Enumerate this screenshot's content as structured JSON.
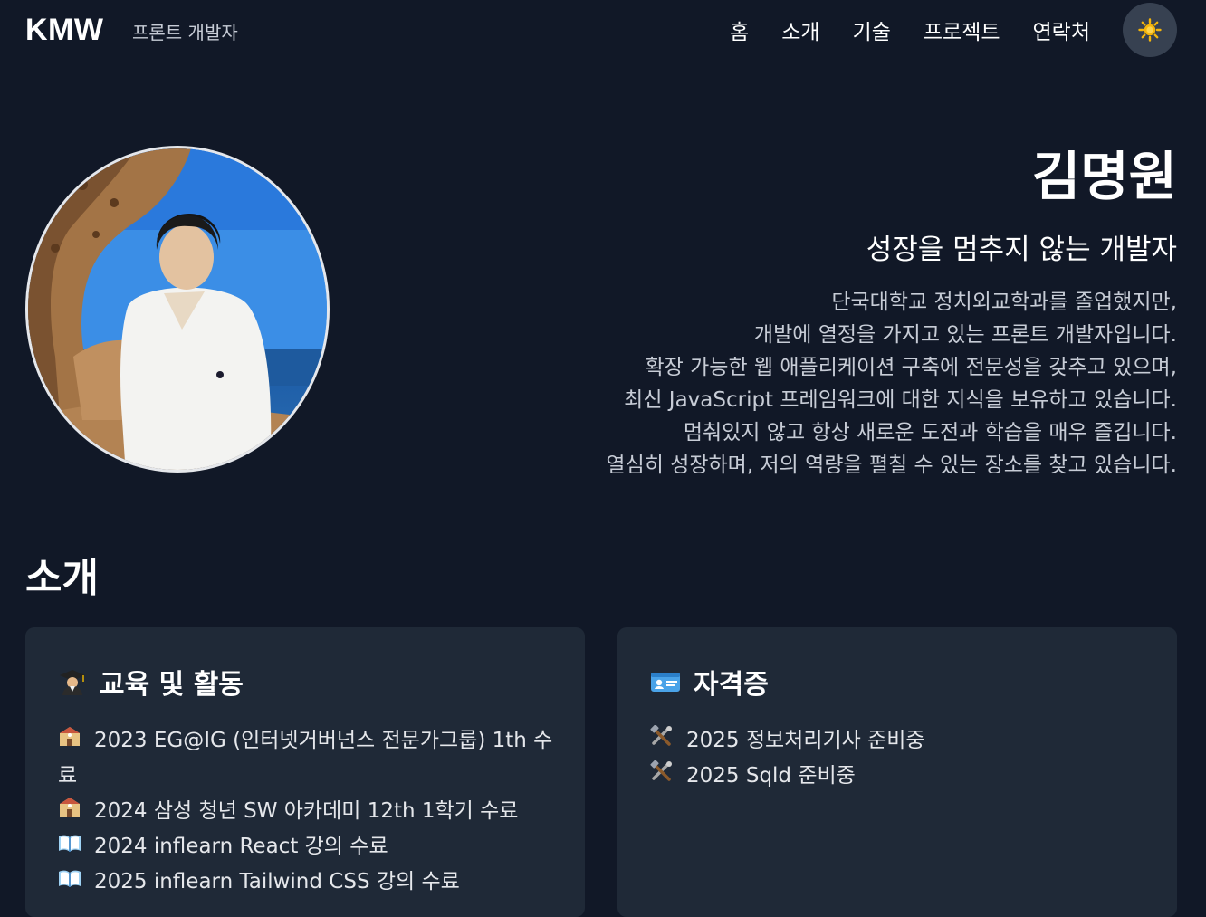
{
  "header": {
    "logo": "KMW",
    "subtitle": "프론트 개발자",
    "nav": [
      "홈",
      "소개",
      "기술",
      "프로젝트",
      "연락처"
    ],
    "theme_icon": "sun-icon"
  },
  "hero": {
    "name": "김명원",
    "tagline": "성장을 멈추지 않는 개발자",
    "bio": [
      "단국대학교 정치외교학과를 졸업했지만,",
      "개발에 열정을 가지고 있는 프론트 개발자입니다.",
      "확장 가능한 웹 애플리케이션 구축에 전문성을 갖추고 있으며,",
      "최신 JavaScript 프레임워크에 대한 지식을 보유하고 있습니다.",
      "멈춰있지 않고 항상 새로운 도전과 학습을 매우 즐깁니다.",
      "열심히 성장하며, 저의 역량을 펼칠 수 있는 장소를 찾고 있습니다."
    ]
  },
  "about": {
    "title": "소개",
    "education": {
      "icon": "graduate-icon",
      "title": "교육 및 활동",
      "items": [
        {
          "icon": "school-icon",
          "text": "2023 EG@IG (인터넷거버넌스 전문가그룹) 1th 수료"
        },
        {
          "icon": "school-icon",
          "text": "2024 삼성 청년 SW 아카데미 12th 1학기 수료"
        },
        {
          "icon": "book-icon",
          "text": "2024 inflearn React 강의 수료"
        },
        {
          "icon": "book-icon",
          "text": "2025 inflearn Tailwind CSS 강의 수료"
        }
      ]
    },
    "certificates": {
      "icon": "id-card-icon",
      "title": "자격증",
      "items": [
        {
          "icon": "tools-icon",
          "text": "2025 정보처리기사 준비중"
        },
        {
          "icon": "tools-icon",
          "text": "2025 Sqld 준비중"
        }
      ]
    }
  }
}
